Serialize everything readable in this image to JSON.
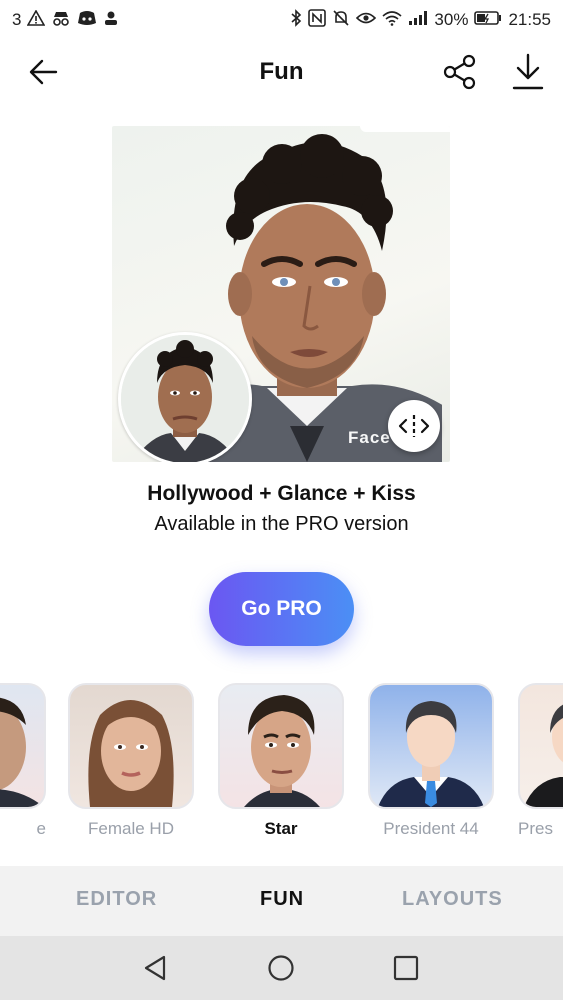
{
  "status_bar": {
    "left_text": "3",
    "left_icons": [
      "warning-icon",
      "incognito-icon",
      "discord-icon",
      "person-icon"
    ],
    "right_icons": [
      "bluetooth-icon",
      "nfc-icon",
      "mute-icon",
      "eye-icon",
      "wifi-icon",
      "signal-icon"
    ],
    "battery": "30%",
    "time": "21:55"
  },
  "appbar": {
    "title": "Fun"
  },
  "preview": {
    "watermark": "Face"
  },
  "caption": {
    "title": "Hollywood + Glance + Kiss",
    "subtitle": "Available in the PRO version"
  },
  "go_pro": {
    "label": "Go PRO"
  },
  "filters": [
    {
      "label": "e"
    },
    {
      "label": "Female HD"
    },
    {
      "label": "Star"
    },
    {
      "label": "President 44"
    },
    {
      "label": "Pres"
    }
  ],
  "tabs": [
    {
      "label": "EDITOR"
    },
    {
      "label": "FUN"
    },
    {
      "label": "LAYOUTS"
    }
  ],
  "colors": {
    "gopro_start": "#6b57f2",
    "gopro_end": "#4b8ff5",
    "tab_inactive": "#9aa2ad"
  }
}
